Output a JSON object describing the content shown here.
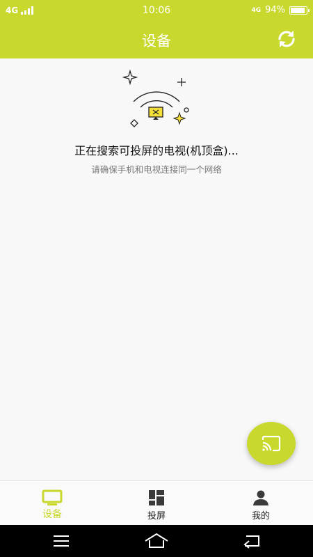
{
  "status_bar": {
    "network_left": "4G",
    "time": "10:06",
    "network_right": "4G",
    "battery": "94%"
  },
  "header": {
    "title": "设备",
    "refresh_icon": "refresh-icon",
    "background": "#c8d82c"
  },
  "main": {
    "searching_text": "正在搜索可投屏的电视(机顶盒)...",
    "hint_text": "请确保手机和电视连接同一个网络"
  },
  "fab": {
    "icon": "cast-icon"
  },
  "tabs": [
    {
      "label": "设备",
      "icon": "tv-icon",
      "active": true
    },
    {
      "label": "投屏",
      "icon": "grid-icon",
      "active": false
    },
    {
      "label": "我的",
      "icon": "person-icon",
      "active": false
    }
  ],
  "nav": {
    "menu_icon": "menu-icon",
    "home_icon": "home-icon",
    "back_icon": "back-icon"
  },
  "colors": {
    "accent": "#c8d82c",
    "tv_screen": "#f5e03a"
  }
}
